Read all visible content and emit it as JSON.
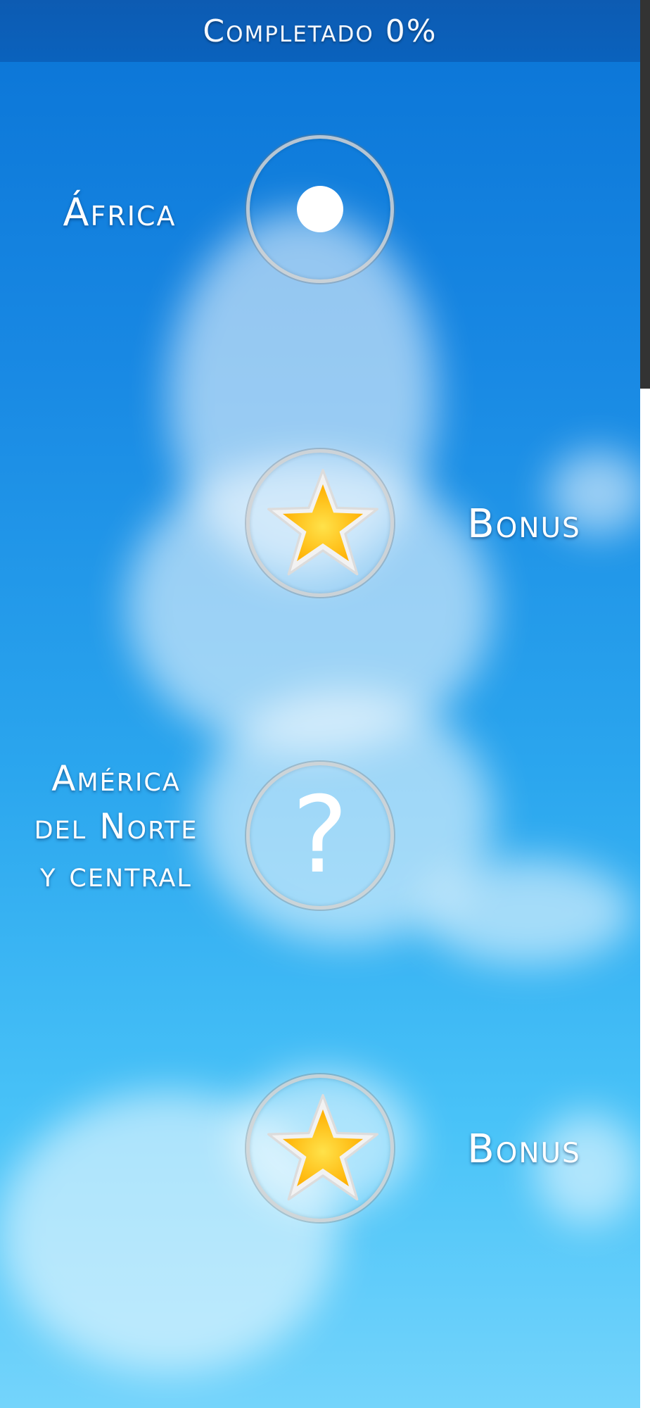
{
  "header": {
    "title": "Completado 0%"
  },
  "levels": [
    {
      "label": "África",
      "icon": "dot-icon",
      "state": "current"
    },
    {
      "label": "Bonus",
      "icon": "star-icon",
      "state": "bonus"
    },
    {
      "label_lines": [
        "América",
        "del Norte",
        "y central"
      ],
      "icon": "question-mark-icon",
      "state": "locked"
    },
    {
      "label": "Bonus",
      "icon": "star-icon",
      "state": "bonus"
    }
  ],
  "colors": {
    "header": "#0a5fb8",
    "sky_top": "#0a74d6",
    "sky_bottom": "#74d4fb",
    "star": "#ffc400"
  }
}
